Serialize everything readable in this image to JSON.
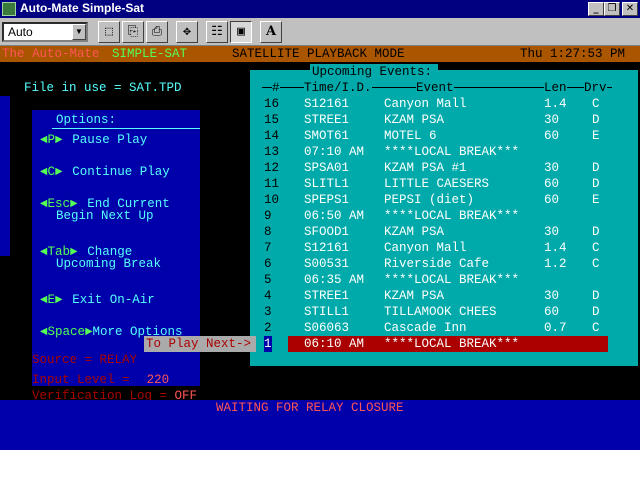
{
  "window": {
    "title": "Auto-Mate Simple-Sat",
    "buttons": [
      "_",
      "❒",
      "✕"
    ]
  },
  "toolbar": {
    "font_value": "Auto",
    "buttons": [
      "⬚",
      "⎘",
      "⎙",
      "✥",
      "☷",
      "▣",
      "A"
    ]
  },
  "header": {
    "app": "The Auto-Mate",
    "product": "SIMPLE-SAT",
    "mode": "SATELLITE PLAYBACK MODE",
    "datetime": "Thu 1:27:53 PM"
  },
  "file_in_use": "File in use = SAT.TPD",
  "options": {
    "title": "Options:",
    "items": [
      {
        "key": "P",
        "label": "Pause Play",
        "label2": ""
      },
      {
        "key": "C",
        "label": "Continue Play",
        "label2": ""
      },
      {
        "key": "Esc",
        "label": "End Current",
        "label2": "Begin Next Up"
      },
      {
        "key": "Tab",
        "label": "Change",
        "label2": "Upcoming Break"
      },
      {
        "key": "E",
        "label": "Exit On-Air",
        "label2": ""
      },
      {
        "key": "Space",
        "label": "More Options",
        "label2": ""
      }
    ]
  },
  "upcoming": {
    "title": "Upcoming Events:",
    "columns": {
      "num": "#",
      "time": "Time/I.D.",
      "event": "Event",
      "len": "Len",
      "drv": "Drv"
    },
    "rows": [
      {
        "num": "16",
        "time": "S12161",
        "event": "Canyon Mall",
        "len": "1.4",
        "drv": "C"
      },
      {
        "num": "15",
        "time": "STREE1",
        "event": "KZAM PSA",
        "len": "30",
        "drv": "D"
      },
      {
        "num": "14",
        "time": "SMOT61",
        "event": "MOTEL 6",
        "len": "60",
        "drv": "E"
      },
      {
        "num": "13",
        "time": "07:10 AM",
        "event": "****LOCAL BREAK***",
        "len": "",
        "drv": ""
      },
      {
        "num": "12",
        "time": "SPSA01",
        "event": "KZAM PSA #1",
        "len": "30",
        "drv": "D"
      },
      {
        "num": "11",
        "time": "SLITL1",
        "event": "LITTLE CAESERS",
        "len": "60",
        "drv": "D"
      },
      {
        "num": "10",
        "time": "SPEPS1",
        "event": "PEPSI (diet)",
        "len": "60",
        "drv": "E"
      },
      {
        "num": "9",
        "time": "06:50 AM",
        "event": "****LOCAL BREAK***",
        "len": "",
        "drv": ""
      },
      {
        "num": "8",
        "time": "SFOOD1",
        "event": "KZAM PSA",
        "len": "30",
        "drv": "D"
      },
      {
        "num": "7",
        "time": "S12161",
        "event": "Canyon Mall",
        "len": "1.4",
        "drv": "C"
      },
      {
        "num": "6",
        "time": "S00531",
        "event": "Riverside Cafe",
        "len": "1.2",
        "drv": "C"
      },
      {
        "num": "5",
        "time": "06:35 AM",
        "event": "****LOCAL BREAK***",
        "len": "",
        "drv": ""
      },
      {
        "num": "4",
        "time": "STREE1",
        "event": "KZAM PSA",
        "len": "30",
        "drv": "D"
      },
      {
        "num": "3",
        "time": "STILL1",
        "event": "TILLAMOOK CHEES",
        "len": "60",
        "drv": "D"
      },
      {
        "num": "2",
        "time": "S06063",
        "event": "Cascade Inn",
        "len": "0.7",
        "drv": "C"
      },
      {
        "num": "1",
        "time": "06:10 AM",
        "event": "****LOCAL BREAK***",
        "len": "",
        "drv": ""
      }
    ]
  },
  "to_play_next": "To Play Next->",
  "source": "Source = RELAY",
  "input_level": {
    "label": "Input Level = ",
    "value": "220"
  },
  "verification": {
    "label": "Verification Log = ",
    "value": "OFF"
  },
  "status": "WAITING FOR RELAY CLOSURE",
  "colors": {
    "header_bg": "#aa5500",
    "cyan_panel": "#00aaaa",
    "blue_panel": "#0000aa",
    "selected_row": "#aa0000",
    "key_green": "#55ff55",
    "text_red": "#ff5555"
  }
}
